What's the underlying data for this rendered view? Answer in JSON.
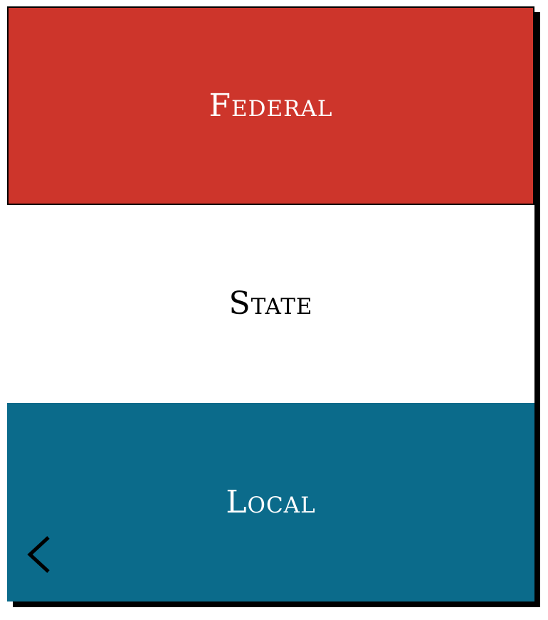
{
  "panels": {
    "federal": {
      "label": "Federal",
      "bg": "#cd352b",
      "fg": "#ffffff"
    },
    "state": {
      "label": "State",
      "bg": "#ffffff",
      "fg": "#000000"
    },
    "local": {
      "label": "Local",
      "bg": "#0b6b8b",
      "fg": "#ffffff"
    }
  },
  "back_button": {
    "icon": "chevron-left-icon"
  }
}
